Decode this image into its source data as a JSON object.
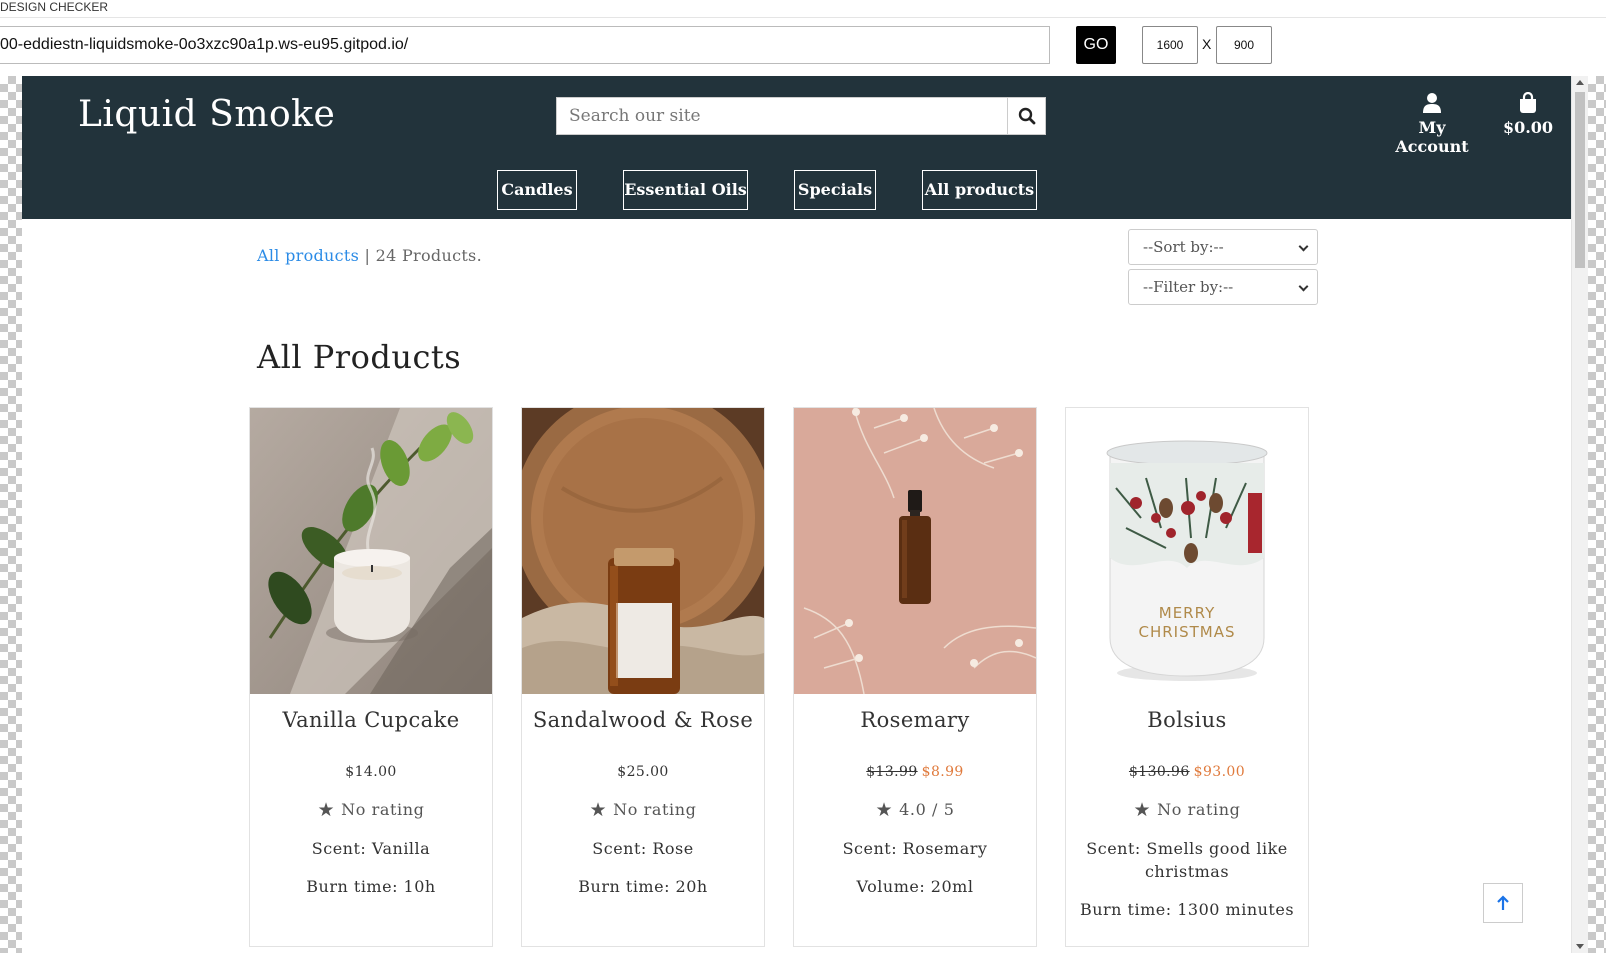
{
  "checker": {
    "title": "DESIGN CHECKER",
    "url": "00-eddiestn-liquidsmoke-0o3xzc90a1p.ws-eu95.gitpod.io/",
    "go_label": "GO",
    "width": "1600",
    "x_label": "X",
    "height": "900"
  },
  "header": {
    "logo": "Liquid Smoke",
    "search_placeholder": "Search our site",
    "account_label": "My Account",
    "bag_total": "$0.00",
    "nav": [
      "Candles",
      "Essential Oils",
      "Specials",
      "All products"
    ]
  },
  "listing": {
    "crumb_link": "All products",
    "crumb_sep": " | ",
    "product_count": "24 Products.",
    "sort_label": "--Sort by:--",
    "filter_label": "--Filter by:--",
    "section_title": "All Products"
  },
  "products": [
    {
      "name": "Vanilla Cupcake",
      "price": "$14.00",
      "old_price": "",
      "sale_price": "",
      "rating": "No rating",
      "scent": "Scent: Vanilla",
      "extra": "Burn time: 10h"
    },
    {
      "name": "Sandalwood & Rose",
      "price": "$25.00",
      "old_price": "",
      "sale_price": "",
      "rating": "No rating",
      "scent": "Scent: Rose",
      "extra": "Burn time: 20h"
    },
    {
      "name": "Rosemary",
      "price": "",
      "old_price": "$13.99",
      "sale_price": "$8.99",
      "rating": "4.0 / 5",
      "scent": "Scent: Rosemary",
      "extra": "Volume: 20ml"
    },
    {
      "name": "Bolsius",
      "price": "",
      "old_price": "$130.96",
      "sale_price": "$93.00",
      "rating": "No rating",
      "scent": "Scent: Smells good like christmas",
      "extra": "Burn time: 1300 minutes",
      "label_text": [
        "MERRY",
        "CHRISTMAS"
      ]
    }
  ],
  "colors": {
    "header_bg": "#22333b",
    "link": "#2b8be6",
    "sale": "#e07a3c"
  }
}
